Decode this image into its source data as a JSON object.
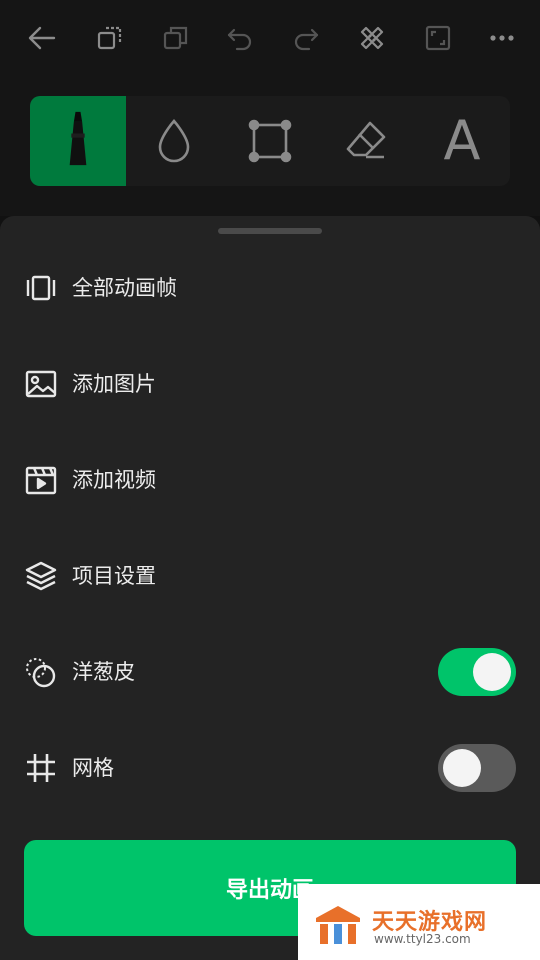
{
  "topbar": {
    "icons": [
      "back-arrow-icon",
      "duplicate-layer-icon",
      "copy-icon",
      "undo-icon",
      "redo-icon",
      "ruler-pencil-icon",
      "fullscreen-icon",
      "more-icon"
    ]
  },
  "tools": {
    "active": "pen",
    "items": [
      "pen-icon",
      "fill-drop-icon",
      "transform-icon",
      "eraser-icon",
      "text-tool-icon"
    ],
    "text_tool_glyph": "A"
  },
  "menu": {
    "all_frames": "全部动画帧",
    "add_image": "添加图片",
    "add_video": "添加视频",
    "project_settings": "项目设置",
    "onion_skin": "洋葱皮",
    "grid": "网格"
  },
  "toggles": {
    "onion_skin_on": true,
    "grid_on": false
  },
  "export": {
    "label": "导出动画"
  },
  "watermark": {
    "title": "天天游戏网",
    "url": "www.ttyl23.com"
  },
  "colors": {
    "accent": "#00c46a",
    "active_tool": "#007a3d",
    "sheet": "#232323",
    "background": "#151515",
    "watermark_orange": "#e8702a"
  }
}
